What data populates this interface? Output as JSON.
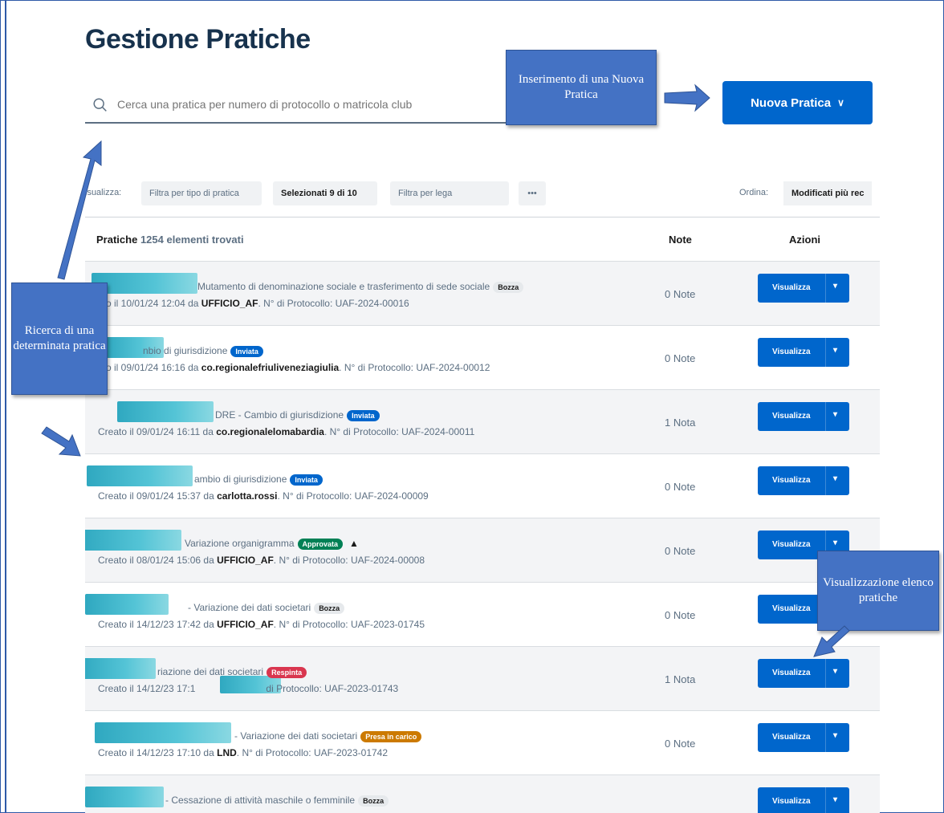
{
  "page": {
    "title": "Gestione Pratiche"
  },
  "search": {
    "placeholder": "Cerca una pratica per numero di protocollo o matricola club"
  },
  "new_button": {
    "label": "Nuova Pratica"
  },
  "filters": {
    "label": "isualizza:",
    "chips": [
      "Filtra per tipo di pratica",
      "Selezionati 9 di 10",
      "Filtra per lega",
      "•••"
    ],
    "order_label": "Ordina:",
    "order_value": "Modificati più rec"
  },
  "table": {
    "title": "Pratiche",
    "count": "1254 elementi trovati",
    "col_note": "Note",
    "col_actions": "Azioni",
    "view_label": "Visualizza",
    "rows": [
      {
        "line1": "Mutamento di denominazione sociale e trasferimento di sede sociale",
        "badge": "Bozza",
        "badge_type": "bozza",
        "line2_pre": "ato il 10/01/24 12:04 da ",
        "user": "UFFICIO_AF",
        "line2_post": ". N° di Protocollo: UAF-2024-00016",
        "note": "0 Note"
      },
      {
        "line1": "nbio di giurisdizione",
        "badge": "Inviata",
        "badge_type": "inviata",
        "line2_pre": "ato il 09/01/24 16:16 da ",
        "user": "co.regionalefriuliveneziagiulia",
        "line2_post": ". N° di Protocollo: UAF-2024-00012",
        "note": "0 Note"
      },
      {
        "line1": "DRE - Cambio di giurisdizione",
        "badge": "Inviata",
        "badge_type": "inviata",
        "line2_pre": "Creato il 09/01/24 16:11 da ",
        "user": "co.regionalelomabardia",
        "line2_post": ". N° di Protocollo: UAF-2024-00011",
        "note": "1 Nota"
      },
      {
        "line1": "ambio di giurisdizione",
        "badge": "Inviata",
        "badge_type": "inviata",
        "line2_pre": "Creato il 09/01/24 15:37 da ",
        "user": "carlotta.rossi",
        "line2_post": ". N° di Protocollo: UAF-2024-00009",
        "note": "0 Note"
      },
      {
        "line1": "Variazione organigramma",
        "badge": "Approvata",
        "badge_type": "approvata",
        "warn": "▲",
        "line2_pre": "Creato il 08/01/24 15:06 da ",
        "user": "UFFICIO_AF",
        "line2_post": ". N° di Protocollo: UAF-2024-00008",
        "note": "0 Note"
      },
      {
        "line1": "- Variazione dei dati societari",
        "badge": "Bozza",
        "badge_type": "bozza",
        "line2_pre": "Creato il 14/12/23 17:42 da ",
        "user": "UFFICIO_AF",
        "line2_post": ". N° di Protocollo: UAF-2023-01745",
        "note": "0 Note"
      },
      {
        "line1": "riazione dei dati societari",
        "badge": "Respinta",
        "badge_type": "respinta",
        "line2_pre": "Creato il 14/12/23 17:1",
        "user": "",
        "line2_post": "di Protocollo: UAF-2023-01743",
        "note": "1 Nota"
      },
      {
        "line1": "- Variazione dei dati societari",
        "badge": "Presa in carico",
        "badge_type": "presa",
        "line2_pre": "Creato il 14/12/23 17:10 da ",
        "user": "LND",
        "line2_post": ". N° di Protocollo: UAF-2023-01742",
        "note": "0 Note"
      },
      {
        "line1": "- Cessazione di attività maschile o femminile",
        "badge": "Bozza",
        "badge_type": "bozza",
        "line2_pre": "",
        "user": "",
        "line2_post": "",
        "note": ""
      }
    ]
  },
  "callouts": {
    "insert": "Inserimento di una Nuova Pratica",
    "search": "Ricerca di una determinata pratica",
    "list": "Visualizzazione elenco pratiche"
  }
}
